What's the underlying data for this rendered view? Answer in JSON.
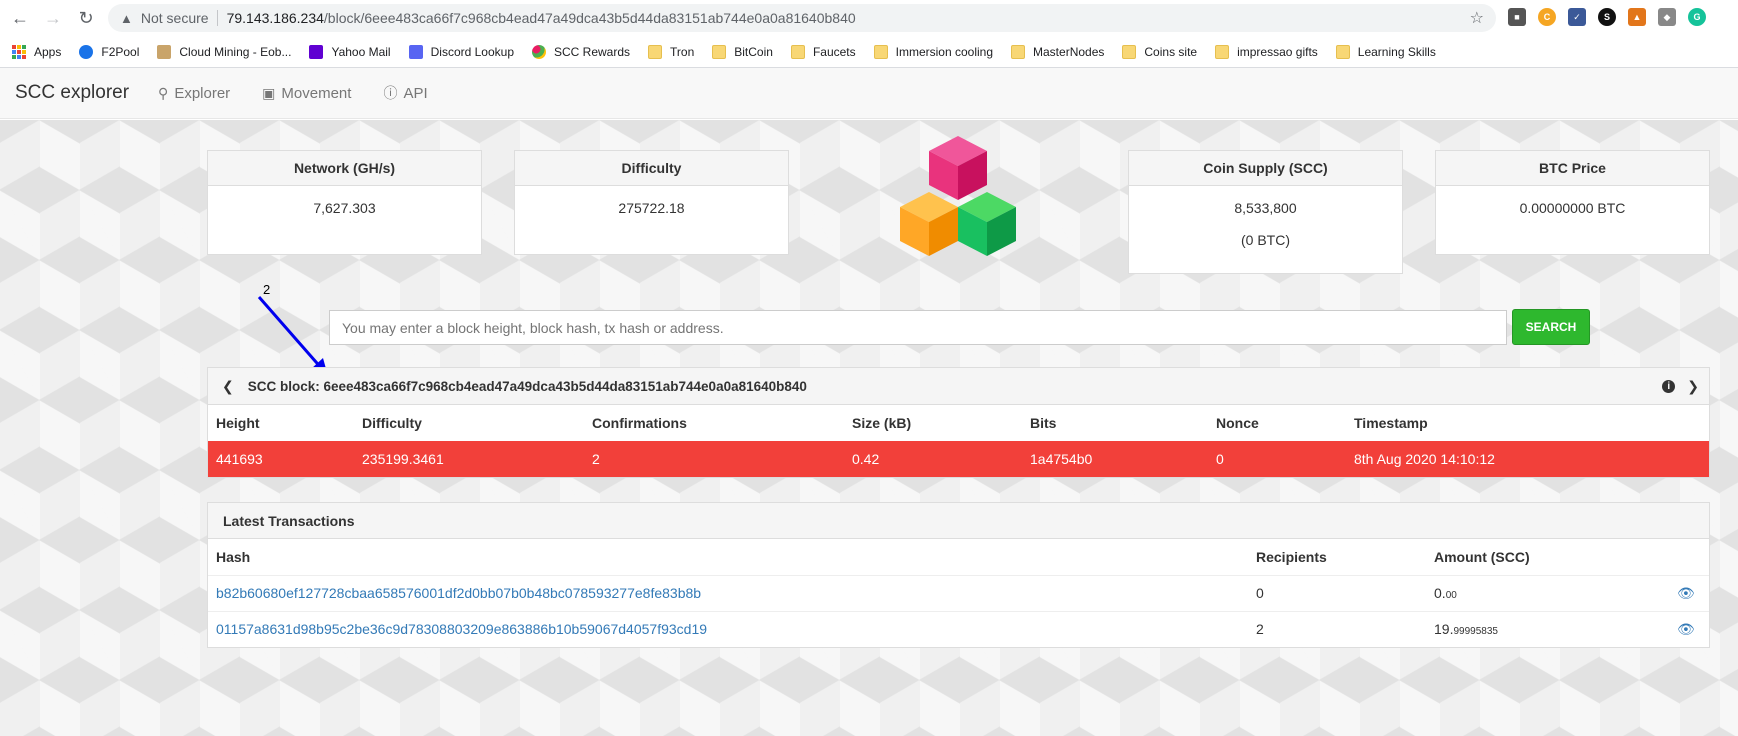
{
  "browser": {
    "not_secure": "Not secure",
    "url_host": "79.143.186.234",
    "url_path": "/block/6eee483ca66f7c968cb4ead47a49dca43b5d44da83151ab744e0a0a81640b840"
  },
  "bookmarks": [
    {
      "label": "Apps",
      "icon": "apps-grid"
    },
    {
      "label": "F2Pool",
      "icon": "f2pool-icon"
    },
    {
      "label": "Cloud Mining - Eob...",
      "icon": "cloud-mining-icon"
    },
    {
      "label": "Yahoo Mail",
      "icon": "yahoo-mail-icon"
    },
    {
      "label": "Discord Lookup",
      "icon": "discord-lookup-icon"
    },
    {
      "label": "SCC Rewards",
      "icon": "scc-rewards-icon"
    },
    {
      "label": "Tron",
      "icon": "folder"
    },
    {
      "label": "BitCoin",
      "icon": "folder"
    },
    {
      "label": "Faucets",
      "icon": "folder"
    },
    {
      "label": "Immersion cooling",
      "icon": "folder"
    },
    {
      "label": "MasterNodes",
      "icon": "folder"
    },
    {
      "label": "Coins site",
      "icon": "folder"
    },
    {
      "label": "impressao gifts",
      "icon": "folder"
    },
    {
      "label": "Learning Skills",
      "icon": "folder"
    }
  ],
  "nav": {
    "brand": "SCC explorer",
    "explorer": "Explorer",
    "movement": "Movement",
    "api": "API"
  },
  "stats": {
    "network_label": "Network (GH/s)",
    "network_value": "7,627.303",
    "difficulty_label": "Difficulty",
    "difficulty_value": "275722.18",
    "supply_label": "Coin Supply (SCC)",
    "supply_value": "8,533,800",
    "supply_btc": "(0 BTC)",
    "price_label": "BTC Price",
    "price_value": "0.00000000 BTC"
  },
  "annotation": {
    "number": "2"
  },
  "search": {
    "placeholder": "You may enter a block height, block hash, tx hash or address.",
    "button": "SEARCH"
  },
  "block": {
    "title": "SCC block: 6eee483ca66f7c968cb4ead47a49dca43b5d44da83151ab744e0a0a81640b840",
    "headers": {
      "height": "Height",
      "difficulty": "Difficulty",
      "confirmations": "Confirmations",
      "size": "Size (kB)",
      "bits": "Bits",
      "nonce": "Nonce",
      "timestamp": "Timestamp"
    },
    "row": {
      "height": "441693",
      "difficulty": "235199.3461",
      "confirmations": "2",
      "size": "0.42",
      "bits": "1a4754b0",
      "nonce": "0",
      "timestamp": "8th Aug 2020 14:10:12"
    }
  },
  "transactions": {
    "title": "Latest Transactions",
    "headers": {
      "hash": "Hash",
      "recipients": "Recipients",
      "amount": "Amount (SCC)"
    },
    "rows": [
      {
        "hash": "b82b60680ef127728cbaa658576001df2d0bb07b0b48bc078593277e8fe83b8b",
        "recipients": "0",
        "amount_int": "0.",
        "amount_dec": "00"
      },
      {
        "hash": "01157a8631d98b95c2be36c9d78308803209e863886b10b59067d4057f93cd19",
        "recipients": "2",
        "amount_int": "19.",
        "amount_dec": "99995835"
      }
    ]
  },
  "colors": {
    "red_row": "#f2403a",
    "search_green": "#2eb82e",
    "link_blue": "#337ab7",
    "annotation_blue": "#0000ee"
  }
}
